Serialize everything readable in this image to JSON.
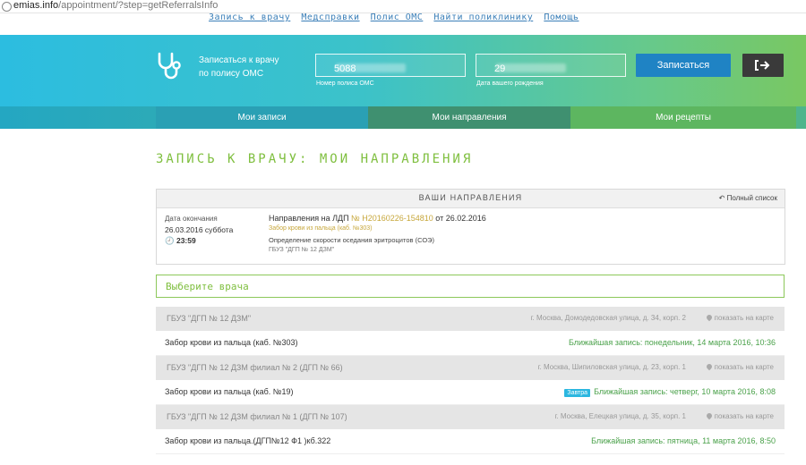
{
  "browser": {
    "url_host": "emias.info",
    "url_path": "/appointment/?step=getReferralsInfo"
  },
  "top_links": [
    "Запись к врачу",
    "Медсправки",
    "Полис ОМС",
    "Найти поликлинику",
    "Помощь"
  ],
  "header": {
    "line1": "Записаться к врачу",
    "line2": "по полису ОМС",
    "policy_value": "5088",
    "policy_label": "Номер полиса ОМС",
    "dob_value": "29",
    "dob_label": "Дата вашего рождения",
    "submit_label": "Записаться"
  },
  "tabs": [
    "Мои записи",
    "Мои направления",
    "Мои рецепты"
  ],
  "page_title": "ЗАПИСЬ К ВРАЧУ: МОИ НАПРАВЛЕНИЯ",
  "referrals": {
    "heading": "ВАШИ НАПРАВЛЕНИЯ",
    "full_list": "Полный список",
    "end_label": "Дата окончания",
    "end_date": "26.03.2016 суббота",
    "end_time": "23:59",
    "referral_prefix": "Направления на ЛДП ",
    "referral_number": "№ Н20160226-154810",
    "referral_suffix": " от 26.02.2016",
    "procedure": "Забор крови из пальца (каб. №303)",
    "test": "Определение скорости оседания эритроцитов (СОЭ)",
    "clinic": "ГБУЗ \"ДГП № 12 ДЗМ\""
  },
  "select_doctor": "Выберите врача",
  "map_link": "показать на карте",
  "clinics": [
    {
      "name": "ГБУЗ \"ДГП № 12 ДЗМ\"",
      "address": "г. Москва, Домодедовская улица, д. 34, корп. 2",
      "service": "Забор крови из пальца (каб. №303)",
      "badge": "",
      "next": "Ближайшая запись: понедельник, 14 марта 2016, 10:36"
    },
    {
      "name": "ГБУЗ \"ДГП № 12 ДЗМ филиал № 2 (ДГП № 66)",
      "address": "г. Москва, Шипиловская улица, д. 23, корп. 1",
      "service": "Забор крови из пальца (каб. №19)",
      "badge": "Завтра",
      "next": "Ближайшая запись: четверг, 10 марта 2016, 8:08"
    },
    {
      "name": "ГБУЗ \"ДГП № 12 ДЗМ филиал № 1 (ДГП № 107)",
      "address": "г. Москва, Елецкая улица, д. 35, корп. 1",
      "service": "Забор крови из пальца.(ДГП№12 Ф1 )кб.322",
      "badge": "",
      "next": "Ближайшая запись: пятница, 11 марта 2016, 8:50"
    }
  ],
  "colors": {
    "accent_green": "#7fbf3f",
    "button_blue": "#1f83c4",
    "badge_blue": "#2bb7e0"
  }
}
